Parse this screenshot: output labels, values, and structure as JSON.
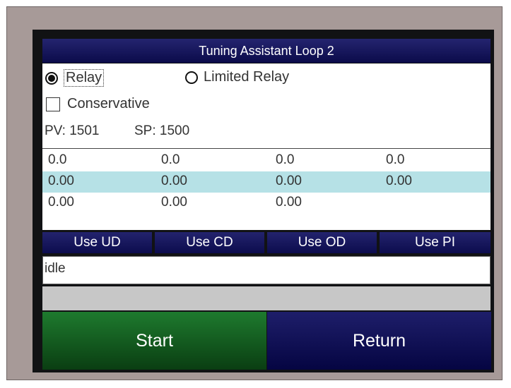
{
  "title": "Tuning Assistant Loop 2",
  "mode": {
    "options": [
      {
        "label": "Relay",
        "selected": true
      },
      {
        "label": "Limited Relay",
        "selected": false
      }
    ]
  },
  "conservative": {
    "label": "Conservative",
    "checked": false
  },
  "pv": "PV: 1501",
  "sp": "SP: 1500",
  "table": {
    "rows": [
      [
        "0.0",
        "0.0",
        "0.0",
        "0.0"
      ],
      [
        "0.00",
        "0.00",
        "0.00",
        "0.00"
      ],
      [
        "0.00",
        "0.00",
        "0.00",
        ""
      ]
    ]
  },
  "use_buttons": [
    "Use UD",
    "Use CD",
    "Use OD",
    "Use PI"
  ],
  "status": "idle",
  "actions": {
    "start": "Start",
    "return": "Return"
  },
  "colors": {
    "header": "#13135a",
    "start_button": "#15632a",
    "return_button": "#0c0c55",
    "row_highlight": "#b6e1e6",
    "bezel": "#a79a98"
  }
}
